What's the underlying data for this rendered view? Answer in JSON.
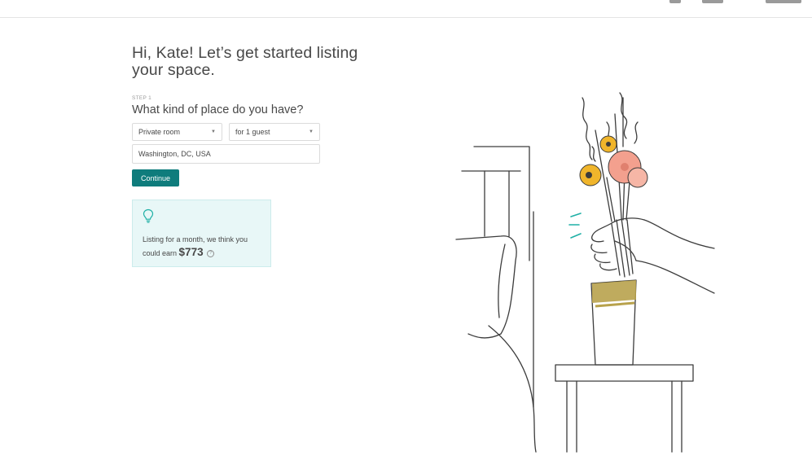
{
  "header": {},
  "page": {
    "title": "Hi, Kate! Let’s get started listing your space."
  },
  "step": {
    "label": "STEP 1",
    "question": "What kind of place do you have?"
  },
  "form": {
    "room_type": {
      "value": "Private room"
    },
    "guests": {
      "value": "for 1 guest"
    },
    "location": {
      "value": "Washington, DC, USA"
    },
    "continue_label": "Continue"
  },
  "tip": {
    "text": "Listing for a month, we think you could earn",
    "amount": "$773",
    "info_glyph": "?"
  },
  "icons": {
    "bulb": "lightbulb-icon",
    "info": "info-icon",
    "dropdown": "chevron-down-icon"
  },
  "colors": {
    "accent": "#0f7c7c",
    "tip_background": "#e8f7f7",
    "text": "#484848"
  }
}
